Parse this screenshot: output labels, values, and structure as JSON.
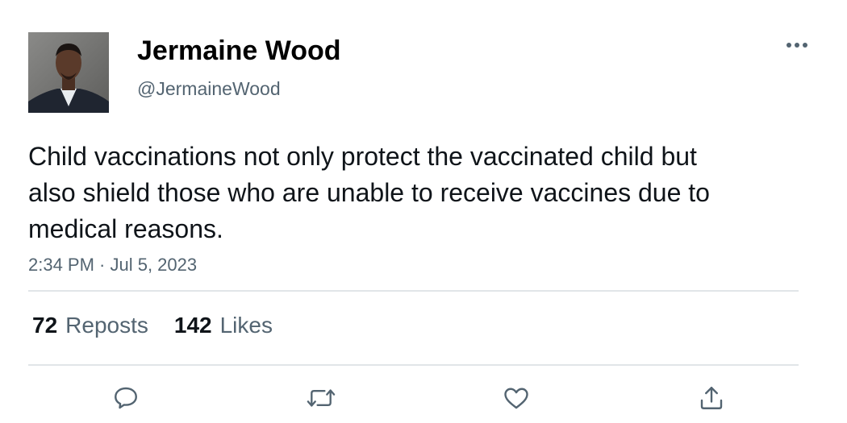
{
  "author": {
    "display_name": "Jermaine Wood",
    "handle": "@JermaineWood",
    "avatar_icon": "profile-photo"
  },
  "tweet": {
    "text": "Child vaccinations not only protect the vaccinated child but also shield those who are unable to receive vaccines due to medical reasons.",
    "timestamp": "2:34 PM · Jul 5, 2023"
  },
  "stats": {
    "reposts_count": "72",
    "reposts_label": "Reposts",
    "likes_count": "142",
    "likes_label": "Likes"
  },
  "actions": [
    {
      "name": "reply",
      "icon": "speech-bubble-icon"
    },
    {
      "name": "repost",
      "icon": "repost-arrows-icon"
    },
    {
      "name": "like",
      "icon": "heart-icon"
    },
    {
      "name": "share",
      "icon": "share-upload-icon"
    }
  ],
  "colors": {
    "text_primary": "#0f1419",
    "text_secondary": "#536471",
    "divider": "#e1e5e8",
    "icon": "#536471"
  }
}
